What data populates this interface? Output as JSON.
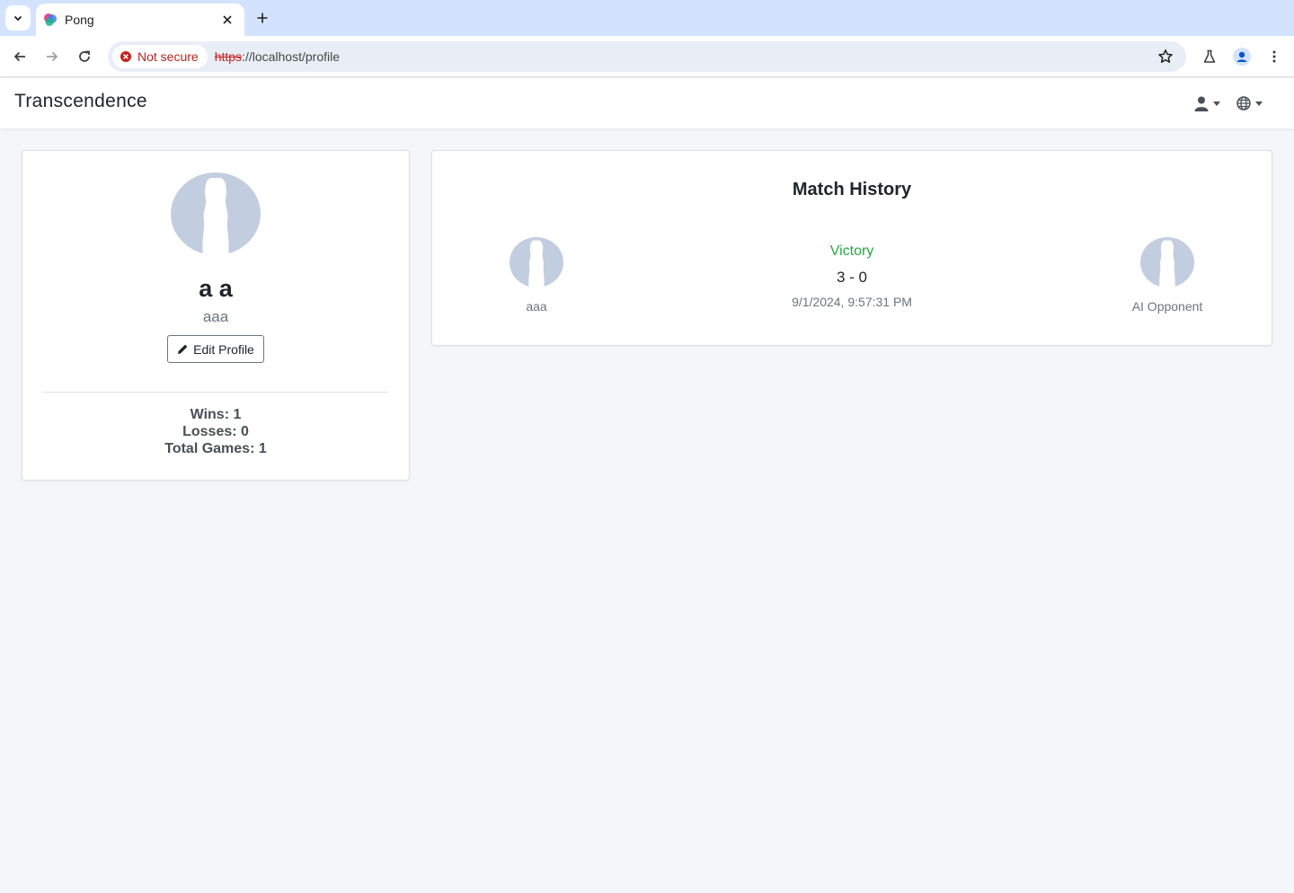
{
  "browser": {
    "tab_title": "Pong",
    "security_label": "Not secure",
    "url_scheme": "https",
    "url_rest": "://localhost/profile"
  },
  "app": {
    "brand": "Transcendence"
  },
  "profile": {
    "full_name": "a a",
    "username": "aaa",
    "edit_label": "Edit Profile",
    "stats": {
      "wins": "Wins: 1",
      "losses": "Losses: 0",
      "total": "Total Games: 1"
    }
  },
  "match_history": {
    "title": "Match History",
    "matches": [
      {
        "player": "aaa",
        "opponent": "AI Opponent",
        "result": "Victory",
        "score": "3 - 0",
        "date": "9/1/2024, 9:57:31 PM"
      }
    ]
  },
  "colors": {
    "victory": "#28a745",
    "avatar_bg": "#c3cde0",
    "page_bg": "#f5f6fa"
  }
}
